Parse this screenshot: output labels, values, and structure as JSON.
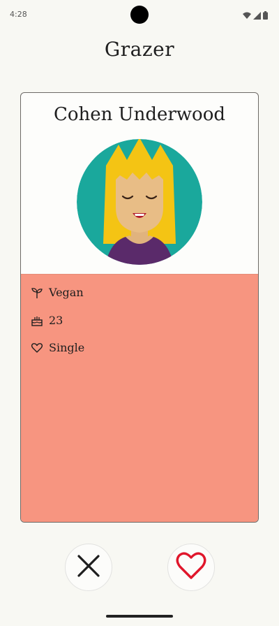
{
  "status_bar": {
    "time": "4:28",
    "icons": [
      "wifi-icon",
      "signal-icon",
      "battery-icon"
    ]
  },
  "app": {
    "title": "Grazer"
  },
  "profile": {
    "name": "Cohen Underwood",
    "details": [
      {
        "icon": "sprout-icon",
        "label": "Vegan"
      },
      {
        "icon": "cake-icon",
        "label": "23"
      },
      {
        "icon": "heart-outline-icon",
        "label": "Single"
      }
    ]
  },
  "actions": {
    "dislike_icon": "close-icon",
    "like_icon": "heart-icon"
  },
  "colors": {
    "details_background": "#f79580",
    "avatar_background": "#1aa89c",
    "like_accent": "#e0162b"
  }
}
